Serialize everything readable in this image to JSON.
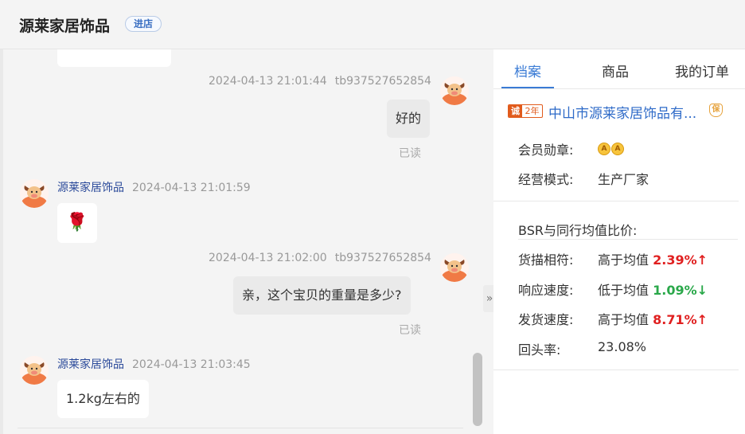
{
  "header": {
    "shop_name": "源莱家居饰品",
    "enter_shop_label": "进店"
  },
  "chat": {
    "messages": [
      {
        "time": "2024-04-13 21:01:44",
        "sender": "tb937527652854",
        "text": "好的",
        "status": "已读"
      },
      {
        "sender": "源莱家居饰品",
        "time": "2024-04-13 21:01:59",
        "emoji": "🌹"
      },
      {
        "time": "2024-04-13 21:02:00",
        "sender": "tb937527652854",
        "text": "亲，这个宝贝的重量是多少?",
        "status": "已读"
      },
      {
        "sender": "源莱家居饰品",
        "time": "2024-04-13 21:03:45",
        "text": "1.2kg左右的"
      }
    ],
    "collapse_label": "»"
  },
  "panel": {
    "tabs": [
      {
        "label": "档案",
        "active": true
      },
      {
        "label": "商品",
        "active": false
      },
      {
        "label": "我的订单",
        "active": false
      }
    ],
    "company": {
      "cheng_badge": "诚",
      "years_badge": "2年",
      "name": "中山市源莱家居饰品有...",
      "bao_icon": "保"
    },
    "member_medal_label": "会员勋章:",
    "business_mode_label": "经营模式:",
    "business_mode_value": "生产厂家",
    "bsr_title": "BSR与同行均值比价:",
    "metrics": [
      {
        "label": "货描相符:",
        "compare": "高于均值",
        "value": "2.39%",
        "direction": "up",
        "arrow": "↑"
      },
      {
        "label": "响应速度:",
        "compare": "低于均值",
        "value": "1.09%",
        "direction": "down",
        "arrow": "↓"
      },
      {
        "label": "发货速度:",
        "compare": "高于均值",
        "value": "8.71%",
        "direction": "up",
        "arrow": "↑"
      }
    ],
    "repeat_rate_label": "回头率:",
    "repeat_rate_value": "23.08%"
  },
  "colors": {
    "accent": "#3a7bd5",
    "up": "#e02020",
    "down": "#2aa84a",
    "badge_orange": "#e15b1c"
  }
}
